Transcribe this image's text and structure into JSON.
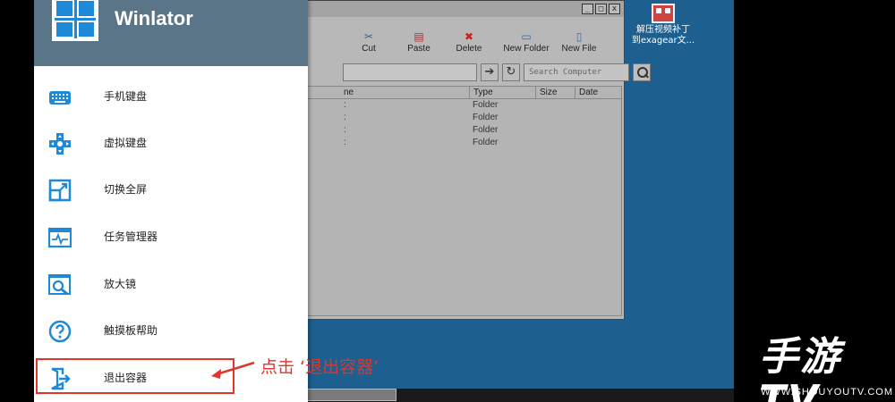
{
  "app": {
    "title": "Winlator"
  },
  "menu": {
    "items": [
      {
        "label": "手机键盘",
        "icon": "keyboard-icon"
      },
      {
        "label": "虚拟键盘",
        "icon": "gamepad-dpad-icon"
      },
      {
        "label": "切换全屏",
        "icon": "fullscreen-icon"
      },
      {
        "label": "任务管理器",
        "icon": "task-manager-icon"
      },
      {
        "label": "放大镜",
        "icon": "magnifier-icon"
      },
      {
        "label": "触摸板帮助",
        "icon": "help-icon"
      },
      {
        "label": "退出容器",
        "icon": "exit-icon"
      }
    ]
  },
  "annotation": {
    "text": "点击 ‘退出容器’"
  },
  "explorer": {
    "toolbar": [
      "Cut",
      "Paste",
      "Delete",
      "New Folder",
      "New File"
    ],
    "search_placeholder": "Search Computer",
    "columns": [
      "Type",
      "Size",
      "Date"
    ],
    "rows": [
      {
        "name_fragment": ":",
        "type": "Folder"
      },
      {
        "name_fragment": ":",
        "type": "Folder"
      },
      {
        "name_fragment": ":",
        "type": "Folder"
      },
      {
        "name_fragment": ":",
        "type": "Folder"
      }
    ],
    "column_fragment": "ne"
  },
  "desktop": {
    "icon_label_1": "解压视频补丁",
    "icon_label_2": "到exagear文..."
  },
  "watermark": {
    "logo": "手游TV",
    "url": "WWW.SHOUYOUTV.COM"
  },
  "colors": {
    "accent": "#1e89d6",
    "header": "#5a7588",
    "annotation": "#e2352a",
    "desktop": "#1d5f8e"
  }
}
